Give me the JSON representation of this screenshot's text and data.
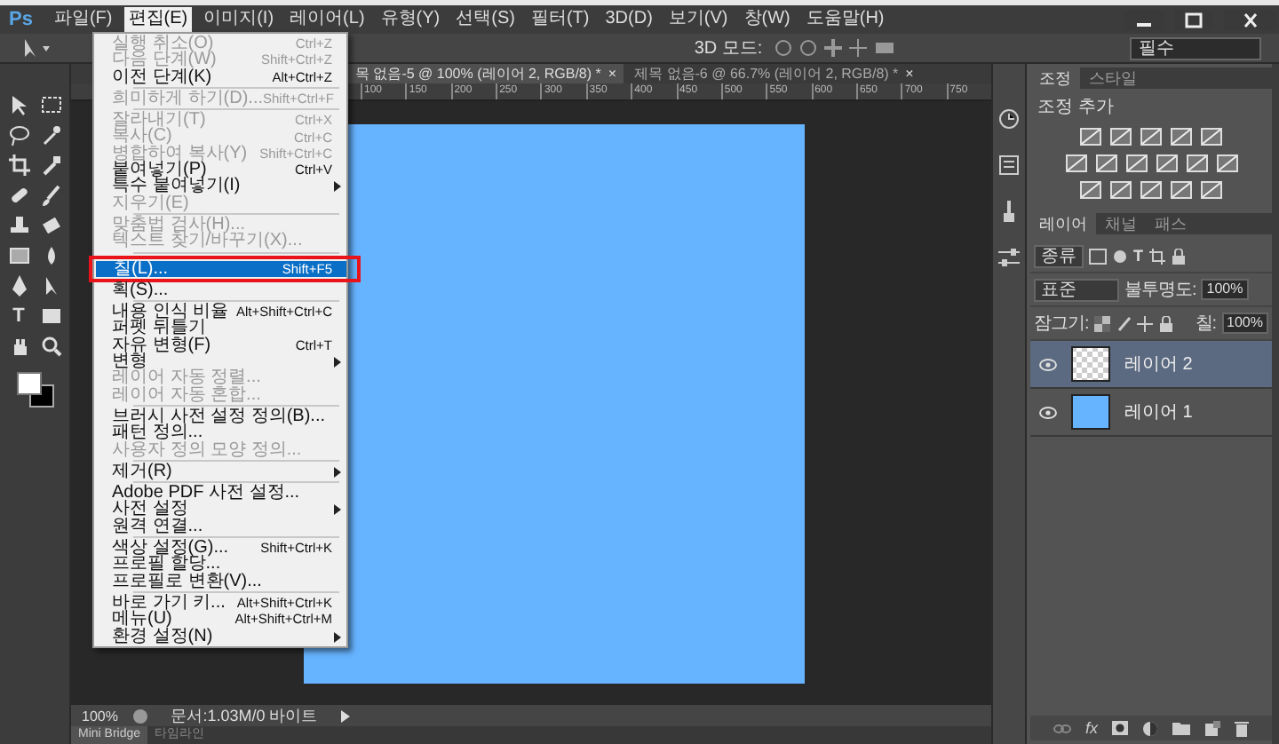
{
  "app": {
    "logo": "Ps"
  },
  "menus": [
    {
      "label": "파일(F)",
      "selected": false
    },
    {
      "label": "편집(E)",
      "selected": true
    },
    {
      "label": "이미지(I)",
      "selected": false
    },
    {
      "label": "레이어(L)",
      "selected": false
    },
    {
      "label": "유형(Y)",
      "selected": false
    },
    {
      "label": "선택(S)",
      "selected": false
    },
    {
      "label": "필터(T)",
      "selected": false
    },
    {
      "label": "3D(D)",
      "selected": false
    },
    {
      "label": "보기(V)",
      "selected": false
    },
    {
      "label": "창(W)",
      "selected": false
    },
    {
      "label": "도움말(H)",
      "selected": false
    }
  ],
  "options_bar": {
    "mode_label": "3D 모드:",
    "workspace": "필수"
  },
  "tools": {
    "type_glyph": "T"
  },
  "document_tabs": [
    {
      "title": "목 없음-5 @ 100% (레이어 2, RGB/8) *",
      "close": "×",
      "selected": true
    },
    {
      "title": "제목 없음-6 @ 66.7% (레이어 2, RGB/8) *",
      "close": "×",
      "selected": false
    }
  ],
  "ruler": [
    "100",
    "150",
    "200",
    "250",
    "300",
    "350",
    "400",
    "450",
    "500",
    "550",
    "600",
    "650",
    "700",
    "750"
  ],
  "edit_menu": [
    {
      "kind": "item",
      "label": "실행 취소(O)",
      "shortcut": "Ctrl+Z",
      "disabled": true,
      "submenu": false,
      "selected": false
    },
    {
      "kind": "item",
      "label": "다음 단계(W)",
      "shortcut": "Shift+Ctrl+Z",
      "disabled": true,
      "submenu": false,
      "selected": false
    },
    {
      "kind": "item",
      "label": "이전 단계(K)",
      "shortcut": "Alt+Ctrl+Z",
      "disabled": false,
      "submenu": false,
      "selected": false
    },
    {
      "kind": "separator"
    },
    {
      "kind": "item",
      "label": "희미하게 하기(D)...",
      "shortcut": "Shift+Ctrl+F",
      "disabled": true,
      "submenu": false,
      "selected": false
    },
    {
      "kind": "separator"
    },
    {
      "kind": "item",
      "label": "잘라내기(T)",
      "shortcut": "Ctrl+X",
      "disabled": true,
      "submenu": false,
      "selected": false
    },
    {
      "kind": "item",
      "label": "복사(C)",
      "shortcut": "Ctrl+C",
      "disabled": true,
      "submenu": false,
      "selected": false
    },
    {
      "kind": "item",
      "label": "병합하여 복사(Y)",
      "shortcut": "Shift+Ctrl+C",
      "disabled": true,
      "submenu": false,
      "selected": false
    },
    {
      "kind": "item",
      "label": "붙여넣기(P)",
      "shortcut": "Ctrl+V",
      "disabled": false,
      "submenu": false,
      "selected": false
    },
    {
      "kind": "item",
      "label": "특수 붙여넣기(I)",
      "disabled": false,
      "submenu": true,
      "selected": false
    },
    {
      "kind": "item",
      "label": "지우기(E)",
      "disabled": true,
      "submenu": false,
      "selected": false
    },
    {
      "kind": "separator"
    },
    {
      "kind": "item",
      "label": "맞춤법 검사(H)...",
      "disabled": true,
      "submenu": false,
      "selected": false
    },
    {
      "kind": "item",
      "label": "텍스트 찾기/바꾸기(X)...",
      "disabled": true,
      "submenu": false,
      "selected": false
    },
    {
      "kind": "separator"
    },
    {
      "kind": "item",
      "label": "칠(L)...",
      "shortcut": "Shift+F5",
      "disabled": false,
      "submenu": false,
      "selected": true
    },
    {
      "kind": "item",
      "label": "획(S)...",
      "disabled": false,
      "submenu": false,
      "selected": false
    },
    {
      "kind": "separator"
    },
    {
      "kind": "item",
      "label": "내용 인식 비율",
      "shortcut": "Alt+Shift+Ctrl+C",
      "disabled": false,
      "submenu": false,
      "selected": false
    },
    {
      "kind": "item",
      "label": "퍼펫 뒤틀기",
      "disabled": false,
      "submenu": false,
      "selected": false
    },
    {
      "kind": "item",
      "label": "자유 변형(F)",
      "shortcut": "Ctrl+T",
      "disabled": false,
      "submenu": false,
      "selected": false
    },
    {
      "kind": "item",
      "label": "변형",
      "disabled": false,
      "submenu": true,
      "selected": false
    },
    {
      "kind": "item",
      "label": "레이어 자동 정렬...",
      "disabled": true,
      "submenu": false,
      "selected": false
    },
    {
      "kind": "item",
      "label": "레이어 자동 혼합...",
      "disabled": true,
      "submenu": false,
      "selected": false
    },
    {
      "kind": "separator"
    },
    {
      "kind": "item",
      "label": "브러시 사전 설정 정의(B)...",
      "disabled": false,
      "submenu": false,
      "selected": false
    },
    {
      "kind": "item",
      "label": "패턴 정의...",
      "disabled": false,
      "submenu": false,
      "selected": false
    },
    {
      "kind": "item",
      "label": "사용자 정의 모양 정의...",
      "disabled": true,
      "submenu": false,
      "selected": false
    },
    {
      "kind": "separator"
    },
    {
      "kind": "item",
      "label": "제거(R)",
      "disabled": false,
      "submenu": true,
      "selected": false
    },
    {
      "kind": "separator"
    },
    {
      "kind": "item",
      "label": "Adobe PDF 사전 설정...",
      "disabled": false,
      "submenu": false,
      "selected": false
    },
    {
      "kind": "item",
      "label": "사전 설정",
      "disabled": false,
      "submenu": true,
      "selected": false
    },
    {
      "kind": "item",
      "label": "원격 연결...",
      "disabled": false,
      "submenu": false,
      "selected": false
    },
    {
      "kind": "separator"
    },
    {
      "kind": "item",
      "label": "색상 설정(G)...",
      "shortcut": "Shift+Ctrl+K",
      "disabled": false,
      "submenu": false,
      "selected": false
    },
    {
      "kind": "item",
      "label": "프로필 할당...",
      "disabled": false,
      "submenu": false,
      "selected": false
    },
    {
      "kind": "item",
      "label": "프로필로 변환(V)...",
      "disabled": false,
      "submenu": false,
      "selected": false
    },
    {
      "kind": "separator"
    },
    {
      "kind": "item",
      "label": "바로 가기 키...",
      "shortcut": "Alt+Shift+Ctrl+K",
      "disabled": false,
      "submenu": false,
      "selected": false
    },
    {
      "kind": "item",
      "label": "메뉴(U)",
      "shortcut": "Alt+Shift+Ctrl+M",
      "disabled": false,
      "submenu": false,
      "selected": false
    },
    {
      "kind": "item",
      "label": "환경 설정(N)",
      "disabled": false,
      "submenu": true,
      "selected": false
    }
  ],
  "status_bar": {
    "zoom": "100%",
    "doc_info": "문서:1.03M/0 바이트"
  },
  "bottom_tabs": [
    {
      "label": "Mini Bridge",
      "selected": true
    },
    {
      "label": "타임라인",
      "selected": false
    }
  ],
  "adjustments_panel": {
    "tabs": [
      {
        "label": "조정",
        "selected": true
      },
      {
        "label": "스타일",
        "selected": false
      }
    ],
    "heading": "조정 추가"
  },
  "layers_panel": {
    "tabs": [
      {
        "label": "레이어",
        "selected": true
      },
      {
        "label": "채널",
        "selected": false
      },
      {
        "label": "패스",
        "selected": false
      }
    ],
    "filter": "종류",
    "filter_type_glyph": "T",
    "blend_mode": "표준",
    "opacity_label": "불투명도:",
    "opacity": "100%",
    "lock_label": "잠그기:",
    "fill_label": "칠:",
    "fill": "100%",
    "footer_fx": "fx",
    "layers": [
      {
        "name": "레이어 2",
        "selected": true,
        "kind": "transparent"
      },
      {
        "name": "레이어 1",
        "selected": false,
        "kind": "fill"
      }
    ]
  }
}
